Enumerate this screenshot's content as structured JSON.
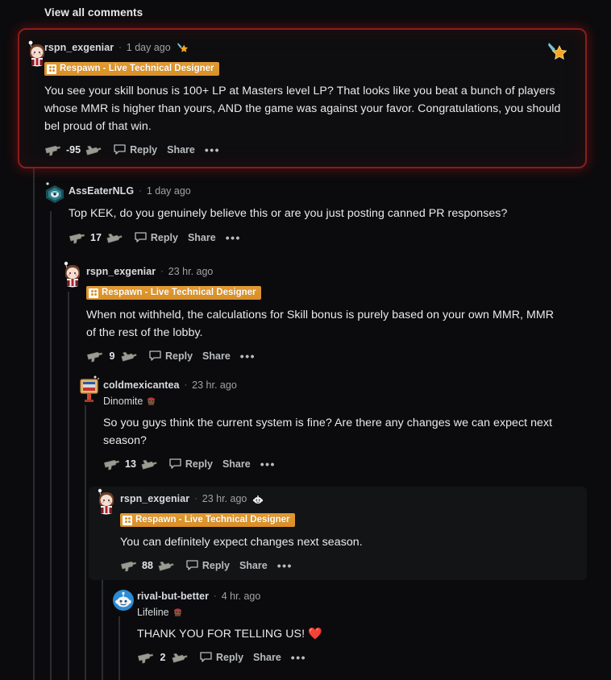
{
  "header": {
    "view_all_label": "View all comments"
  },
  "theme": {
    "page_bg": "#0b0b0d",
    "highlight_border": "#8b1c1c",
    "flair_bg": "#d98f26",
    "text_primary": "#e8eaec",
    "text_muted": "#9fa2a4",
    "threadline": "#2a2d31"
  },
  "actions_labels": {
    "reply": "Reply",
    "share": "Share",
    "more": "•••"
  },
  "comments": [
    {
      "id": "c1",
      "username": "rspn_exgeniar",
      "separator": "·",
      "timestamp": "1 day ago",
      "header_award_icon": "shooting-star-award-icon",
      "corner_award_icon": "shooting-star-award-icon",
      "flair": "Respawn - Live Technical Designer",
      "flair_icon": "respawn-logo-icon",
      "user_flair": null,
      "body": "You see your skill bonus is 100+ LP at Masters level LP? That looks like you beat a bunch of players whose MMR is higher than yours, AND the game was against your favor. Congratulations, you should bel proud of that win.",
      "score": "-95",
      "upvote_icon": "gun-upvote-icon",
      "downvote_icon": "gun-downvote-icon",
      "reply": "Reply",
      "share": "Share",
      "more": "•••",
      "highlighted": true,
      "depth": 0
    },
    {
      "id": "c2",
      "username": "AssEaterNLG",
      "separator": "·",
      "timestamp": "1 day ago",
      "header_award_icon": null,
      "flair": null,
      "user_flair": null,
      "body": "Top KEK, do you genuinely believe this or are you just posting canned PR responses?",
      "score": "17",
      "upvote_icon": "gun-upvote-icon",
      "downvote_icon": "gun-downvote-icon",
      "reply": "Reply",
      "share": "Share",
      "more": "•••",
      "highlighted": false,
      "depth": 1
    },
    {
      "id": "c3",
      "username": "rspn_exgeniar",
      "separator": "·",
      "timestamp": "23 hr. ago",
      "header_award_icon": null,
      "flair": "Respawn - Live Technical Designer",
      "flair_icon": "respawn-logo-icon",
      "user_flair": null,
      "body": "When not withheld, the calculations for Skill bonus is purely based on your own MMR, MMR of the rest of the lobby.",
      "score": "9",
      "upvote_icon": "gun-upvote-icon",
      "downvote_icon": "gun-downvote-icon",
      "reply": "Reply",
      "share": "Share",
      "more": "•••",
      "highlighted": false,
      "depth": 2
    },
    {
      "id": "c4",
      "username": "coldmexicantea",
      "separator": "·",
      "timestamp": "23 hr. ago",
      "header_award_icon": null,
      "flair": null,
      "user_flair": "Dinomite",
      "user_flair_emoji": "lifeline-emoji-icon",
      "body": "So you guys think the current system is fine? Are there any changes we can expect next season?",
      "score": "13",
      "upvote_icon": "gun-upvote-icon",
      "downvote_icon": "gun-downvote-icon",
      "reply": "Reply",
      "share": "Share",
      "more": "•••",
      "highlighted": false,
      "depth": 3
    },
    {
      "id": "c5",
      "username": "rspn_exgeniar",
      "separator": "·",
      "timestamp": "23 hr. ago",
      "header_award_icon": "snoo-award-icon",
      "flair": "Respawn - Live Technical Designer",
      "flair_icon": "respawn-logo-icon",
      "user_flair": null,
      "body": "You can definitely expect changes next season.",
      "score": "88",
      "upvote_icon": "gun-upvote-icon",
      "downvote_icon": "gun-downvote-icon",
      "reply": "Reply",
      "share": "Share",
      "more": "•••",
      "highlighted": true,
      "depth": 4
    },
    {
      "id": "c6",
      "username": "rival-but-better",
      "separator": "·",
      "timestamp": "4 hr. ago",
      "header_award_icon": null,
      "flair": null,
      "user_flair": "Lifeline",
      "user_flair_emoji": "lifeline-emoji-icon",
      "body": "THANK YOU FOR TELLING US! ❤️",
      "score": "2",
      "upvote_icon": "gun-upvote-icon",
      "downvote_icon": "gun-downvote-icon",
      "reply": "Reply",
      "share": "Share",
      "more": "•••",
      "highlighted": false,
      "depth": 5
    }
  ]
}
